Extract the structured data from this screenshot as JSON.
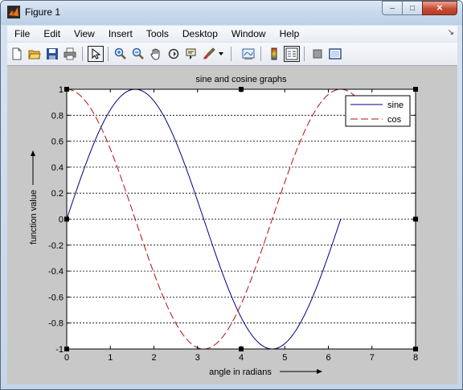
{
  "window": {
    "title": "Figure 1",
    "controls": {
      "minimize": "–",
      "maximize": "□",
      "close": "✕"
    }
  },
  "menubar": {
    "items": [
      "File",
      "Edit",
      "View",
      "Insert",
      "Tools",
      "Desktop",
      "Window",
      "Help"
    ]
  },
  "toolbar": {
    "buttons": [
      "new-figure-icon",
      "open-file-icon",
      "save-icon",
      "print-icon",
      "edit-plot-arrow-icon",
      "zoom-in-icon",
      "zoom-out-icon",
      "pan-hand-icon",
      "rotate-3d-icon",
      "data-cursor-icon",
      "brush-icon",
      "dropdown-arrow-icon",
      "link-plot-icon",
      "colorbar-icon",
      "legend-icon",
      "hide-plot-tools-icon",
      "show-plot-tools-icon"
    ]
  },
  "colors": {
    "sine_line": "#00007f",
    "cosine_line": "#b01010",
    "figure_background": "#c8c8c8",
    "axes_background": "#ffffff"
  },
  "chart_data": {
    "type": "line",
    "title": "sine and cosine graphs",
    "xlabel": "angle in radians",
    "ylabel": "function value",
    "xlim": [
      0,
      8
    ],
    "ylim": [
      -1,
      1
    ],
    "xticks": [
      "0",
      "1",
      "2",
      "3",
      "4",
      "5",
      "6",
      "7",
      "8"
    ],
    "yticks": [
      "-1",
      "-0.8",
      "-0.6",
      "-0.4",
      "-0.2",
      "0",
      "0.2",
      "0.4",
      "0.6",
      "0.8",
      "1"
    ],
    "grid": "y-dashed",
    "legend_position": "top-right",
    "series": [
      {
        "name": "sine",
        "style": "solid",
        "x": [
          0,
          0.5,
          1.0,
          1.5708,
          2.0,
          2.5,
          3.1416,
          3.5,
          4.0,
          4.7124,
          5.0,
          5.5,
          6.0,
          6.2832
        ],
        "y": [
          0,
          0.479,
          0.841,
          1.0,
          0.909,
          0.598,
          0,
          -0.351,
          -0.757,
          -1.0,
          -0.959,
          -0.706,
          -0.279,
          0
        ]
      },
      {
        "name": "cos",
        "style": "dashed",
        "x": [
          0,
          0.5,
          1.0,
          1.5708,
          2.0,
          2.5,
          3.1416,
          3.5,
          4.0,
          4.7124,
          5.0,
          5.5,
          6.0,
          6.2832,
          6.5,
          7.0
        ],
        "y": [
          1.0,
          0.878,
          0.54,
          0,
          -0.416,
          -0.801,
          -1.0,
          -0.936,
          -0.654,
          0,
          0.284,
          0.709,
          0.96,
          1.0,
          0.977,
          0.754
        ]
      }
    ]
  }
}
